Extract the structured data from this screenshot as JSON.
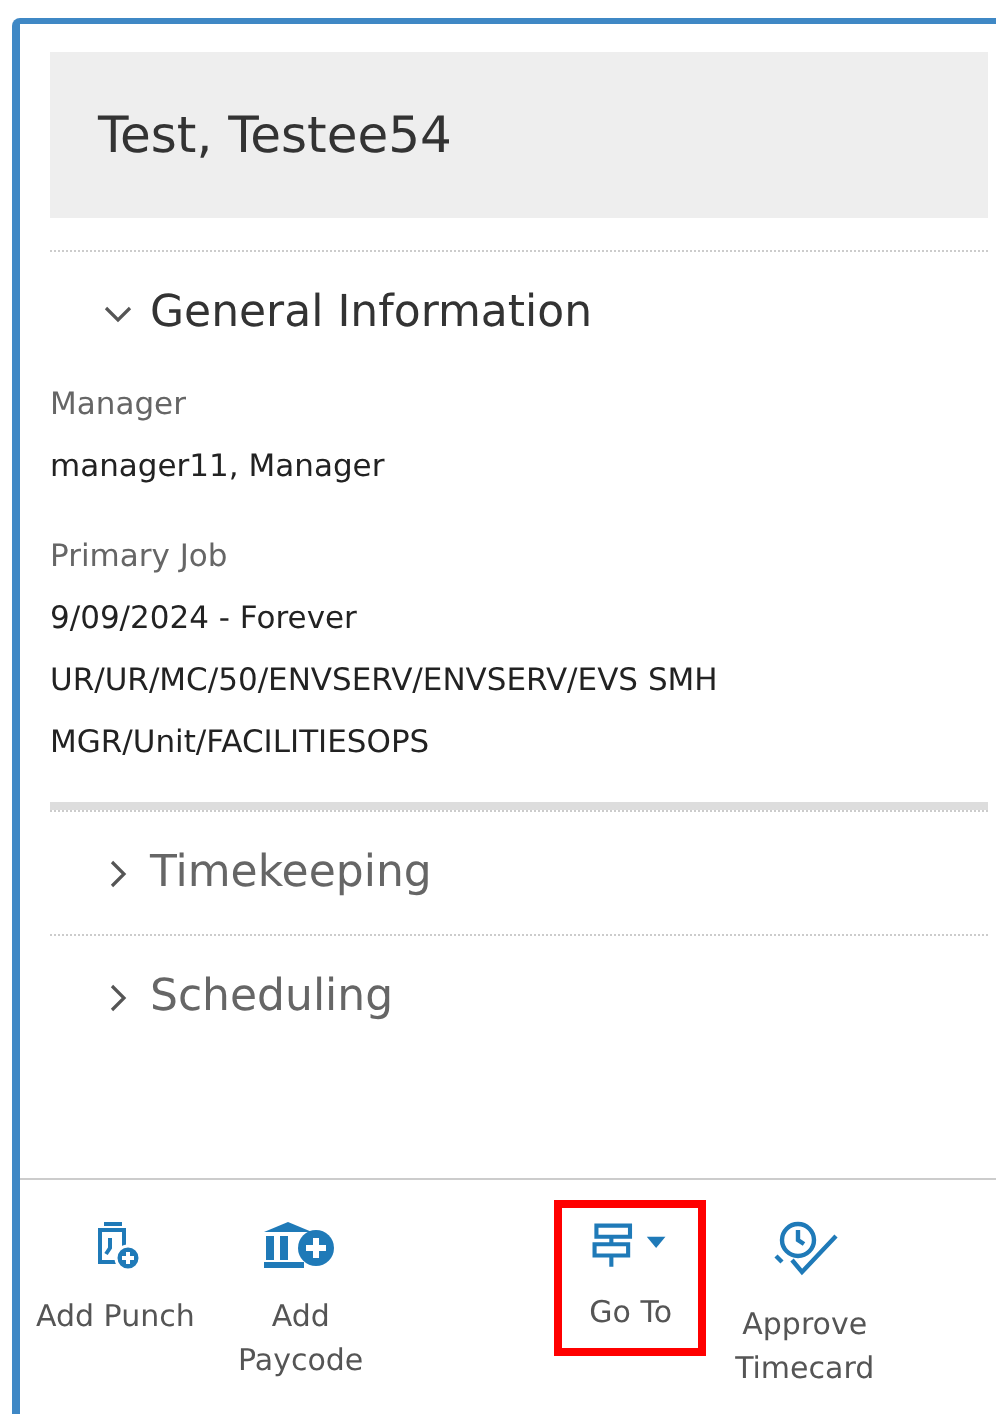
{
  "header": {
    "title": "Test, Testee54"
  },
  "sections": [
    {
      "title": "General Information",
      "expanded": true,
      "fields": [
        {
          "label": "Manager",
          "values": [
            "manager11, Manager"
          ]
        },
        {
          "label": "Primary Job",
          "values": [
            "9/09/2024 - Forever",
            "UR/UR/MC/50/ENVSERV/ENVSERV/EVS SMH MGR/Unit/FACILITIESOPS"
          ]
        }
      ]
    },
    {
      "title": "Timekeeping",
      "expanded": false
    },
    {
      "title": "Scheduling",
      "expanded": false
    }
  ],
  "toolbar": [
    {
      "kind": "punch",
      "label": "Add Punch",
      "highlighted": false
    },
    {
      "kind": "paycode",
      "label": "Add Paycode",
      "highlighted": false
    },
    {
      "kind": "goto",
      "label": "Go To",
      "highlighted": true
    },
    {
      "kind": "approve",
      "label": "Approve Timecard",
      "highlighted": false
    }
  ]
}
